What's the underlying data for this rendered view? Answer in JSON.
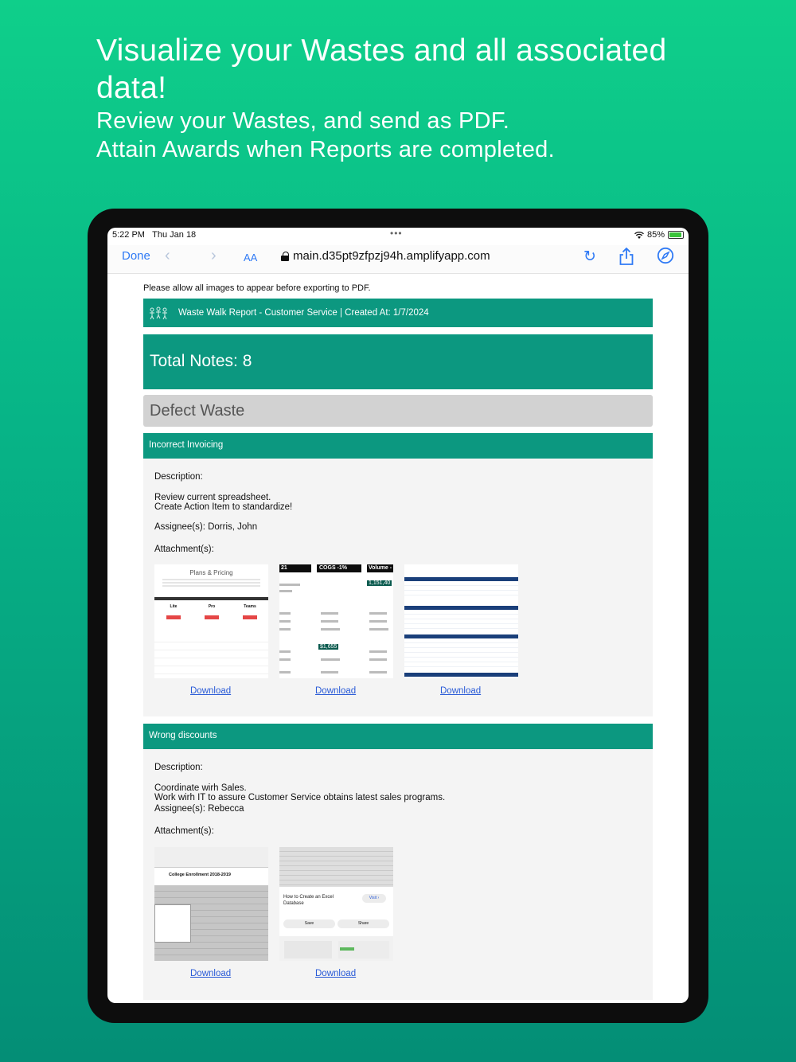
{
  "headline": {
    "title": "Visualize your Wastes and all associated data!",
    "line1": "Review your Wastes, and send as PDF.",
    "line2": "Attain Awards when Reports are completed."
  },
  "status_bar": {
    "time": "5:22 PM",
    "date": "Thu Jan 18",
    "battery": "85%"
  },
  "browser": {
    "done_label": "Done",
    "text_size_label": "AA",
    "url": "main.d35pt9zfpzj94h.amplifyapp.com"
  },
  "page": {
    "notice": "Please allow all images to appear before exporting to PDF.",
    "report_title": "Waste Walk Report - Customer Service | Created At: 1/7/2024",
    "total_notes": "Total Notes: 8",
    "section_title": "Defect Waste",
    "notes": [
      {
        "title": "Incorrect Invoicing",
        "description_label": "Description:",
        "description_lines": [
          "Review current spreadsheet.",
          "Create Action Item to standardize!"
        ],
        "assignees": "Assignee(s): Dorris, John",
        "attachments_label": "Attachment(s):",
        "attachments": [
          {
            "download_label": "Download",
            "thumb_title": "Plans & Pricing",
            "plans": [
              "Lite",
              "Pro",
              "Teams"
            ]
          },
          {
            "download_label": "Download",
            "headers": [
              "21",
              "COGS -1%",
              "Volume -"
            ],
            "highlight_1": "1,151,40",
            "highlight_2": "$1,655"
          },
          {
            "download_label": "Download"
          }
        ]
      },
      {
        "title": "Wrong discounts",
        "description_label": "Description:",
        "description_lines": [
          "Coordinate wirh Sales.",
          "Work wirh IT to assure Customer Service obtains latest sales programs."
        ],
        "assignees": "Assignee(s): Rebecca",
        "attachments_label": "Attachment(s):",
        "attachments": [
          {
            "download_label": "Download",
            "sheet_title": "College Enrollment 2018-2019"
          },
          {
            "download_label": "Download",
            "card_title": "How to Create an Excel Database",
            "visit": "Visit",
            "save": "Save",
            "share": "Share"
          }
        ]
      }
    ]
  },
  "colors": {
    "accent": "#0c9880",
    "link": "#2a5bd7",
    "section_gray": "#d2d2d2"
  }
}
